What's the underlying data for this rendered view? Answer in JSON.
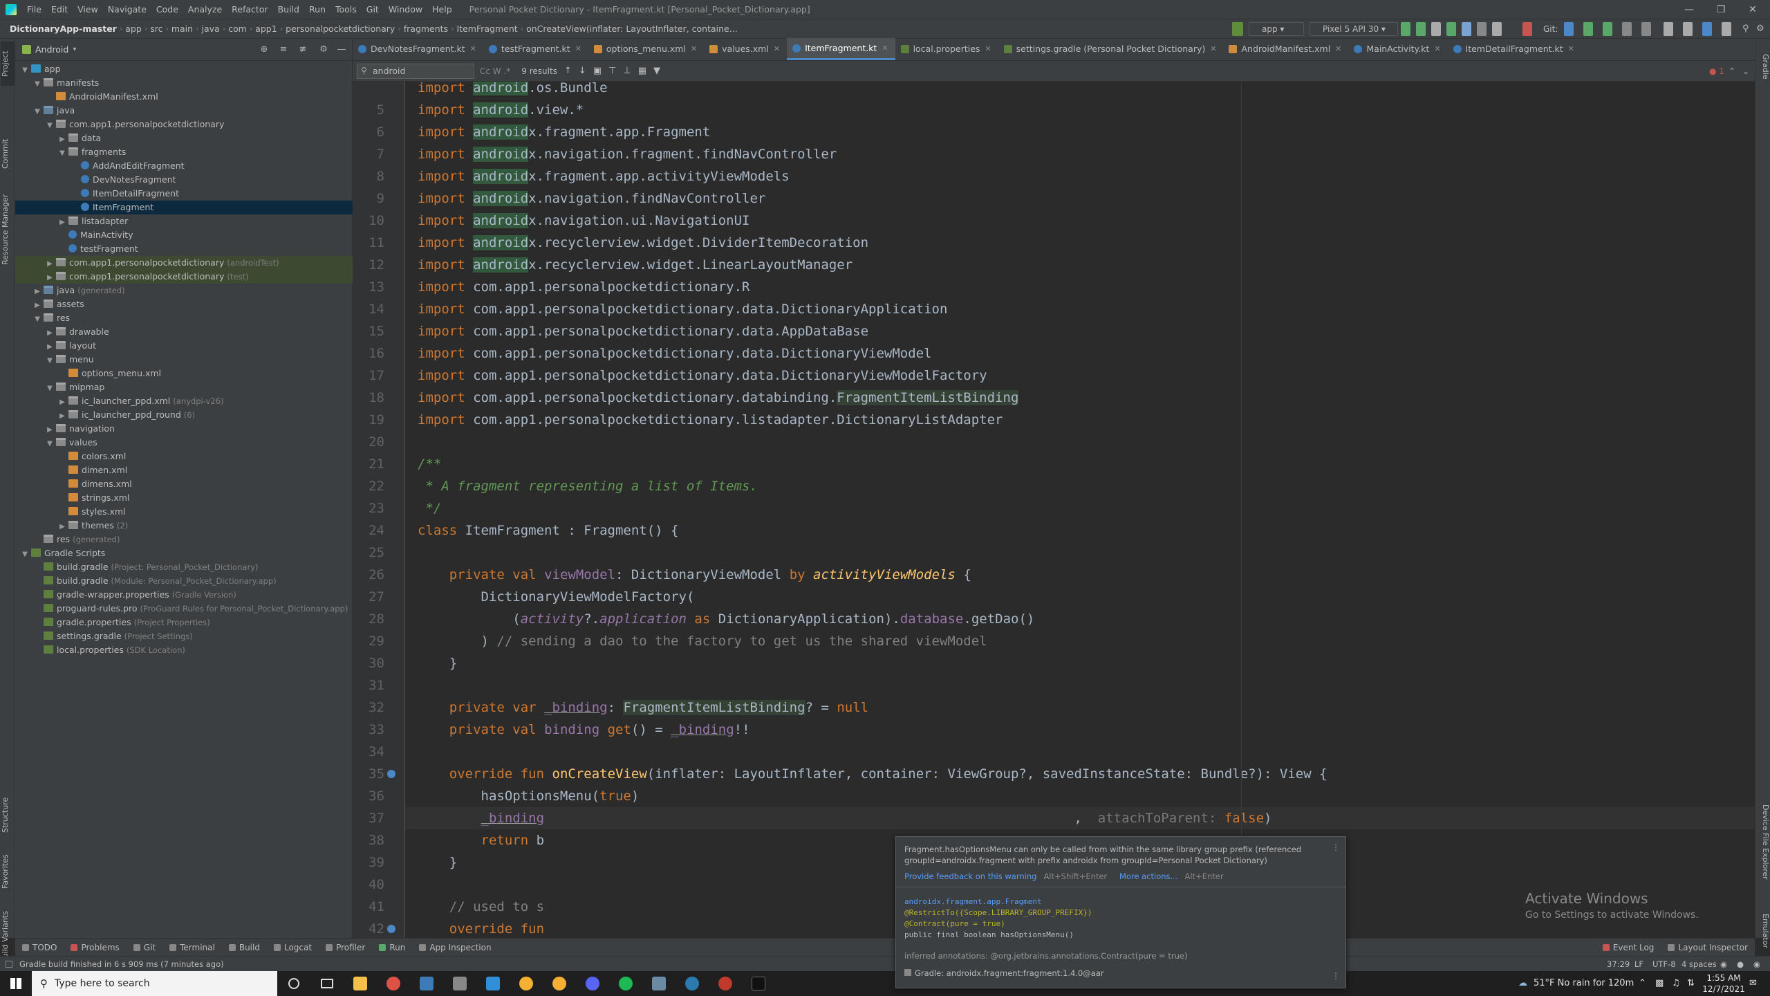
{
  "window": {
    "title": "Personal Pocket Dictionary - ItemFragment.kt [Personal_Pocket_Dictionary.app]",
    "menu": [
      "File",
      "Edit",
      "View",
      "Navigate",
      "Code",
      "Analyze",
      "Refactor",
      "Build",
      "Run",
      "Tools",
      "Git",
      "Window",
      "Help"
    ]
  },
  "breadcrumb": [
    "DictionaryApp-master",
    "app",
    "src",
    "main",
    "java",
    "com",
    "app1",
    "personalpocketdictionary",
    "fragments",
    "ItemFragment",
    "onCreateView(inflater: LayoutInflater, containe..."
  ],
  "toolbar": {
    "run_config": "app",
    "device": "Pixel 5 API 30",
    "git_label": "Git:"
  },
  "project_panel": {
    "view_label": "Android",
    "tree": [
      {
        "label": "app",
        "muted": "",
        "depth": 0,
        "arrow": "down",
        "icon": "mod"
      },
      {
        "label": "manifests",
        "muted": "",
        "depth": 1,
        "arrow": "down",
        "icon": "folder"
      },
      {
        "label": "AndroidManifest.xml",
        "muted": "",
        "depth": 2,
        "arrow": "",
        "icon": "xml"
      },
      {
        "label": "java",
        "muted": "",
        "depth": 1,
        "arrow": "down",
        "icon": "folderb"
      },
      {
        "label": "com.app1.personalpocketdictionary",
        "muted": "",
        "depth": 2,
        "arrow": "down",
        "icon": "pkg"
      },
      {
        "label": "data",
        "muted": "",
        "depth": 3,
        "arrow": "right",
        "icon": "pkg"
      },
      {
        "label": "fragments",
        "muted": "",
        "depth": 3,
        "arrow": "down",
        "icon": "pkg"
      },
      {
        "label": "AddAndEditFragment",
        "muted": "",
        "depth": 4,
        "arrow": "",
        "icon": "kt"
      },
      {
        "label": "DevNotesFragment",
        "muted": "",
        "depth": 4,
        "arrow": "",
        "icon": "kt"
      },
      {
        "label": "ItemDetailFragment",
        "muted": "",
        "depth": 4,
        "arrow": "",
        "icon": "kt"
      },
      {
        "label": "ItemFragment",
        "muted": "",
        "depth": 4,
        "arrow": "",
        "icon": "kt",
        "selected": true
      },
      {
        "label": "listadapter",
        "muted": "",
        "depth": 3,
        "arrow": "right",
        "icon": "pkg"
      },
      {
        "label": "MainActivity",
        "muted": "",
        "depth": 3,
        "arrow": "",
        "icon": "kt"
      },
      {
        "label": "testFragment",
        "muted": "",
        "depth": 3,
        "arrow": "",
        "icon": "kt"
      },
      {
        "label": "com.app1.personalpocketdictionary",
        "muted": "(androidTest)",
        "depth": 2,
        "arrow": "right",
        "icon": "pkg",
        "test": true
      },
      {
        "label": "com.app1.personalpocketdictionary",
        "muted": "(test)",
        "depth": 2,
        "arrow": "right",
        "icon": "pkg",
        "test": true
      },
      {
        "label": "java",
        "muted": "(generated)",
        "depth": 1,
        "arrow": "right",
        "icon": "folderb"
      },
      {
        "label": "assets",
        "muted": "",
        "depth": 1,
        "arrow": "right",
        "icon": "folder"
      },
      {
        "label": "res",
        "muted": "",
        "depth": 1,
        "arrow": "down",
        "icon": "folder"
      },
      {
        "label": "drawable",
        "muted": "",
        "depth": 2,
        "arrow": "right",
        "icon": "folder"
      },
      {
        "label": "layout",
        "muted": "",
        "depth": 2,
        "arrow": "right",
        "icon": "folder"
      },
      {
        "label": "menu",
        "muted": "",
        "depth": 2,
        "arrow": "down",
        "icon": "folder"
      },
      {
        "label": "options_menu.xml",
        "muted": "",
        "depth": 3,
        "arrow": "",
        "icon": "xml"
      },
      {
        "label": "mipmap",
        "muted": "",
        "depth": 2,
        "arrow": "down",
        "icon": "folder"
      },
      {
        "label": "ic_launcher_ppd.xml",
        "muted": "(anydpi-v26)",
        "depth": 3,
        "arrow": "right",
        "icon": "folder"
      },
      {
        "label": "ic_launcher_ppd_round",
        "muted": "(6)",
        "depth": 3,
        "arrow": "right",
        "icon": "folder"
      },
      {
        "label": "navigation",
        "muted": "",
        "depth": 2,
        "arrow": "right",
        "icon": "folder"
      },
      {
        "label": "values",
        "muted": "",
        "depth": 2,
        "arrow": "down",
        "icon": "folder"
      },
      {
        "label": "colors.xml",
        "muted": "",
        "depth": 3,
        "arrow": "",
        "icon": "xml"
      },
      {
        "label": "dimen.xml",
        "muted": "",
        "depth": 3,
        "arrow": "",
        "icon": "xml"
      },
      {
        "label": "dimens.xml",
        "muted": "",
        "depth": 3,
        "arrow": "",
        "icon": "xml"
      },
      {
        "label": "strings.xml",
        "muted": "",
        "depth": 3,
        "arrow": "",
        "icon": "xml"
      },
      {
        "label": "styles.xml",
        "muted": "",
        "depth": 3,
        "arrow": "",
        "icon": "xml"
      },
      {
        "label": "themes",
        "muted": "(2)",
        "depth": 3,
        "arrow": "right",
        "icon": "folder"
      },
      {
        "label": "res",
        "muted": "(generated)",
        "depth": 1,
        "arrow": "",
        "icon": "folder"
      },
      {
        "label": "Gradle Scripts",
        "muted": "",
        "depth": 0,
        "arrow": "down",
        "icon": "gr"
      },
      {
        "label": "build.gradle",
        "muted": "(Project: Personal_Pocket_Dictionary)",
        "depth": 1,
        "arrow": "",
        "icon": "gr"
      },
      {
        "label": "build.gradle",
        "muted": "(Module: Personal_Pocket_Dictionary.app)",
        "depth": 1,
        "arrow": "",
        "icon": "gr"
      },
      {
        "label": "gradle-wrapper.properties",
        "muted": "(Gradle Version)",
        "depth": 1,
        "arrow": "",
        "icon": "gr"
      },
      {
        "label": "proguard-rules.pro",
        "muted": "(ProGuard Rules for Personal_Pocket_Dictionary.app)",
        "depth": 1,
        "arrow": "",
        "icon": "gr"
      },
      {
        "label": "gradle.properties",
        "muted": "(Project Properties)",
        "depth": 1,
        "arrow": "",
        "icon": "gr"
      },
      {
        "label": "settings.gradle",
        "muted": "(Project Settings)",
        "depth": 1,
        "arrow": "",
        "icon": "gr"
      },
      {
        "label": "local.properties",
        "muted": "(SDK Location)",
        "depth": 1,
        "arrow": "",
        "icon": "gr"
      }
    ]
  },
  "left_tool_tabs": [
    "Project",
    "Commit",
    "Resource Manager",
    "Structure",
    "Favorites",
    "Build Variants"
  ],
  "right_tool_tabs": [
    "Gradle",
    "Device File Explorer",
    "Emulator"
  ],
  "editor_tabs": [
    {
      "label": "DevNotesFragment.kt",
      "kind": "kt"
    },
    {
      "label": "testFragment.kt",
      "kind": "kt"
    },
    {
      "label": "options_menu.xml",
      "kind": "xml"
    },
    {
      "label": "values.xml",
      "kind": "xml"
    },
    {
      "label": "ItemFragment.kt",
      "kind": "kt",
      "active": true
    },
    {
      "label": "local.properties",
      "kind": "g"
    },
    {
      "label": "settings.gradle (Personal Pocket Dictionary)",
      "kind": "g"
    },
    {
      "label": "AndroidManifest.xml",
      "kind": "xml"
    },
    {
      "label": "MainActivity.kt",
      "kind": "kt"
    },
    {
      "label": "ItemDetailFragment.kt",
      "kind": "kt"
    }
  ],
  "find": {
    "query": "android",
    "options": "Cc  W  .*",
    "results": "9 results"
  },
  "editor": {
    "warning_count": "1",
    "lines": [
      {
        "n": "",
        "html": "<span class=\"kw\">import</span> <span class=\"hl\">android</span>.os.Bundle"
      },
      {
        "n": "5",
        "html": "<span class=\"kw\">import</span> <span class=\"hl\">android</span>.view.*"
      },
      {
        "n": "6",
        "html": "<span class=\"kw\">import</span> <span class=\"hl\">android</span>x.fragment.app.Fragment"
      },
      {
        "n": "7",
        "html": "<span class=\"kw\">import</span> <span class=\"hl\">android</span>x.navigation.fragment.findNavController"
      },
      {
        "n": "8",
        "html": "<span class=\"kw\">import</span> <span class=\"hl\">android</span>x.fragment.app.activityViewModels"
      },
      {
        "n": "9",
        "html": "<span class=\"kw\">import</span> <span class=\"hl\">android</span>x.navigation.findNavController"
      },
      {
        "n": "10",
        "html": "<span class=\"kw\">import</span> <span class=\"hl\">android</span>x.navigation.ui.NavigationUI"
      },
      {
        "n": "11",
        "html": "<span class=\"kw\">import</span> <span class=\"hl\">android</span>x.recyclerview.widget.DividerItemDecoration"
      },
      {
        "n": "12",
        "html": "<span class=\"kw\">import</span> <span class=\"hl\">android</span>x.recyclerview.widget.LinearLayoutManager"
      },
      {
        "n": "13",
        "html": "<span class=\"kw\">import</span> com.app1.personalpocketdictionary.R"
      },
      {
        "n": "14",
        "html": "<span class=\"kw\">import</span> com.app1.personalpocketdictionary.data.DictionaryApplication"
      },
      {
        "n": "15",
        "html": "<span class=\"kw\">import</span> com.app1.personalpocketdictionary.data.AppDataBase"
      },
      {
        "n": "16",
        "html": "<span class=\"kw\">import</span> com.app1.personalpocketdictionary.data.DictionaryViewModel"
      },
      {
        "n": "17",
        "html": "<span class=\"kw\">import</span> com.app1.personalpocketdictionary.data.DictionaryViewModelFactory"
      },
      {
        "n": "18",
        "html": "<span class=\"kw\">import</span> com.app1.personalpocketdictionary.databinding.<span class=\"hl2\">FragmentItemListBinding</span>"
      },
      {
        "n": "19",
        "html": "<span class=\"kw\">import</span> com.app1.personalpocketdictionary.listadapter.DictionaryListAdapter"
      },
      {
        "n": "20",
        "html": ""
      },
      {
        "n": "21",
        "html": "<span class=\"dc\">/**</span>"
      },
      {
        "n": "22",
        "html": "<span class=\"dc\"> * A fragment representing a list of Items.</span>"
      },
      {
        "n": "23",
        "html": "<span class=\"dc\"> */</span>"
      },
      {
        "n": "24",
        "html": "<span class=\"kw\">class</span> ItemFragment : Fragment() {"
      },
      {
        "n": "25",
        "html": ""
      },
      {
        "n": "26",
        "html": "    <span class=\"kw\">private val</span> <span class=\"pr\">viewModel</span>: DictionaryViewModel <span class=\"kw\">by</span> <span class=\"ex\">activityViewModels</span> {"
      },
      {
        "n": "27",
        "html": "        DictionaryViewModelFactory("
      },
      {
        "n": "28",
        "html": "            (<span class=\"it\">activity</span>?.<span class=\"it\">application</span> <span class=\"kw\">as</span> DictionaryApplication).<span class=\"pr\">database</span>.getDao()"
      },
      {
        "n": "29",
        "html": "        ) <span class=\"cm\">// sending a dao to the factory to get us the shared viewModel</span>"
      },
      {
        "n": "30",
        "html": "    }"
      },
      {
        "n": "31",
        "html": ""
      },
      {
        "n": "32",
        "html": "    <span class=\"kw\">private var</span> <span class=\"pr ul\">_binding</span>: <span class=\"hl2\">FragmentItemListBinding</span>? = <span class=\"kw\">null</span>"
      },
      {
        "n": "33",
        "html": "    <span class=\"kw\">private val</span> <span class=\"pr\">binding</span> <span class=\"kw\">get</span>() = <span class=\"pr ul\">_binding</span>!!"
      },
      {
        "n": "34",
        "html": ""
      },
      {
        "n": "35",
        "html": "    <span class=\"kw\">override fun</span> <span class=\"fn\">onCreateView</span>(inflater: LayoutInflater, container: ViewGroup?, savedInstanceState: Bundle?): View {"
      },
      {
        "n": "36",
        "html": "        hasOptionsMenu(<span class=\"kw\">true</span>)"
      },
      {
        "n": "37",
        "html": "        <span class=\"pr ul\">_binding</span>                                                                   ,  <span class=\"hint\">attachToParent:</span> <span class=\"kw\">false</span>)"
      },
      {
        "n": "38",
        "html": "        <span class=\"kw\">return</span> b"
      },
      {
        "n": "39",
        "html": "    }"
      },
      {
        "n": "40",
        "html": ""
      },
      {
        "n": "41",
        "html": "    <span class=\"cm\">// used to s                                                              ot done in xml</span>"
      },
      {
        "n": "42",
        "html": "    <span class=\"kw\">override fun</span>                                                                          ) {"
      }
    ]
  },
  "popup": {
    "message": "Fragment.hasOptionsMenu can only be called from within the same library group prefix (referenced groupId=androidx.fragment with prefix androidx from groupId=Personal Pocket Dictionary)",
    "feedback_link": "Provide feedback on this warning",
    "feedback_shortcut": "Alt+Shift+Enter",
    "actions_link": "More actions...",
    "actions_shortcut": "Alt+Enter",
    "sig_class": "androidx.fragment.app.Fragment",
    "sig_line2": "@RestrictTo({Scope.LIBRARY_GROUP_PREFIX})",
    "sig_line3": "@Contract(pure = true)",
    "sig_line4": "public final boolean hasOptionsMenu()",
    "inferred": "inferred annotations: @org.jetbrains.annotations.Contract(pure = true)",
    "gradle": "Gradle: androidx.fragment:fragment:1.4.0@aar"
  },
  "tool_windows": [
    "TODO",
    "Problems",
    "Git",
    "Terminal",
    "Build",
    "Logcat",
    "Profiler",
    "Run",
    "App Inspection"
  ],
  "tool_windows_right": [
    "Event Log",
    "Layout Inspector"
  ],
  "status": {
    "message": "Gradle build finished in 6 s 909 ms (7 minutes ago)",
    "position": "37:29",
    "line_sep": "LF",
    "encoding": "UTF-8",
    "indent": "4 spaces"
  },
  "activation": {
    "title": "Activate Windows",
    "subtitle": "Go to Settings to activate Windows."
  },
  "taskbar": {
    "search_placeholder": "Type here to search",
    "weather": "51°F  No rain for 120m",
    "time": "1:55 AM",
    "date": "12/7/2021"
  }
}
